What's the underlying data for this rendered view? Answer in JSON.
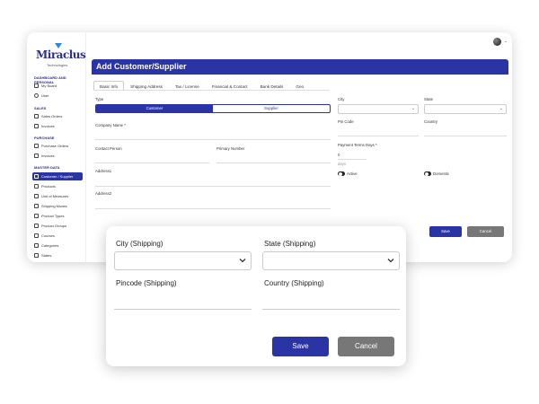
{
  "app": {
    "logo_text": "Miraclus",
    "logo_sub": "Technologies"
  },
  "sidebar": {
    "sections": [
      {
        "label": "DASHBOARD AND PERSONAL",
        "items": [
          "My Board",
          "User"
        ]
      },
      {
        "label": "SALES",
        "items": [
          "Sales Orders",
          "Invoices"
        ]
      },
      {
        "label": "PURCHASE",
        "items": [
          "Purchase Orders",
          "Invoices"
        ]
      },
      {
        "label": "MASTER DATA",
        "items": [
          "Customer / Supplier",
          "Products",
          "Unit of Measures",
          "Shipping Modes",
          "Product Types",
          "Product Groups",
          "Courses",
          "Categories",
          "States"
        ]
      }
    ],
    "active_item": "Customer / Supplier"
  },
  "header": {
    "title": "Add Customer/Supplier"
  },
  "tabs": [
    "Basic Info",
    "Shipping Address",
    "Tax / License",
    "Financial & Contact",
    "Bank Details",
    "Geo"
  ],
  "form_back": {
    "type_label": "Type",
    "type_options": [
      "Customer",
      "Supplier"
    ],
    "company_name_label": "Company Name *",
    "contact_person_label": "Contact Person",
    "primary_number_label": "Primary Number",
    "address1_label": "Address1",
    "address2_label": "Address2",
    "city_label": "City",
    "state_label": "State",
    "pincode_label": "Pin Code",
    "country_label": "Country",
    "payment_terms_label": "Payment Terms Days *",
    "payment_terms_value": "0",
    "payment_terms_unit": "days",
    "active_label": "Active",
    "domestic_label": "Domestic",
    "save_label": "Save",
    "cancel_label": "Cancel"
  },
  "card": {
    "city_label": "City (Shipping)",
    "state_label": "State (Shipping)",
    "pincode_label": "Pincode (Shipping)",
    "country_label": "Country (Shipping)",
    "save_label": "Save",
    "cancel_label": "Cancel"
  },
  "colors": {
    "primary": "#2b34a5",
    "cancel": "#777777"
  }
}
